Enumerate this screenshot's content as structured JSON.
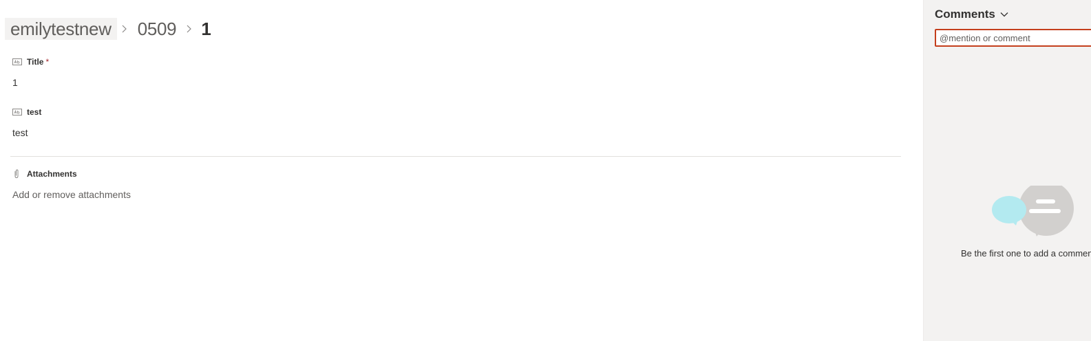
{
  "breadcrumb": {
    "site": "emilytestnew",
    "list": "0509",
    "item": "1"
  },
  "fields": [
    {
      "label": "Title",
      "required_mark": "*",
      "value": "1",
      "icon": "text-field-icon"
    },
    {
      "label": "test",
      "required_mark": "",
      "value": "test",
      "icon": "text-field-icon"
    }
  ],
  "attachments": {
    "label": "Attachments",
    "link": "Add or remove attachments",
    "icon": "paperclip-icon"
  },
  "comments": {
    "title": "Comments",
    "input_placeholder": "@mention or comment",
    "empty_text": "Be the first one to add a comment",
    "illustration": "chat-bubbles-icon"
  },
  "colors": {
    "required": "#a4262c",
    "input_border": "#c43e1c",
    "panel_bg": "#f3f2f1",
    "bubble_teal": "#b3eaf0",
    "bubble_gray": "#d2d0ce"
  }
}
